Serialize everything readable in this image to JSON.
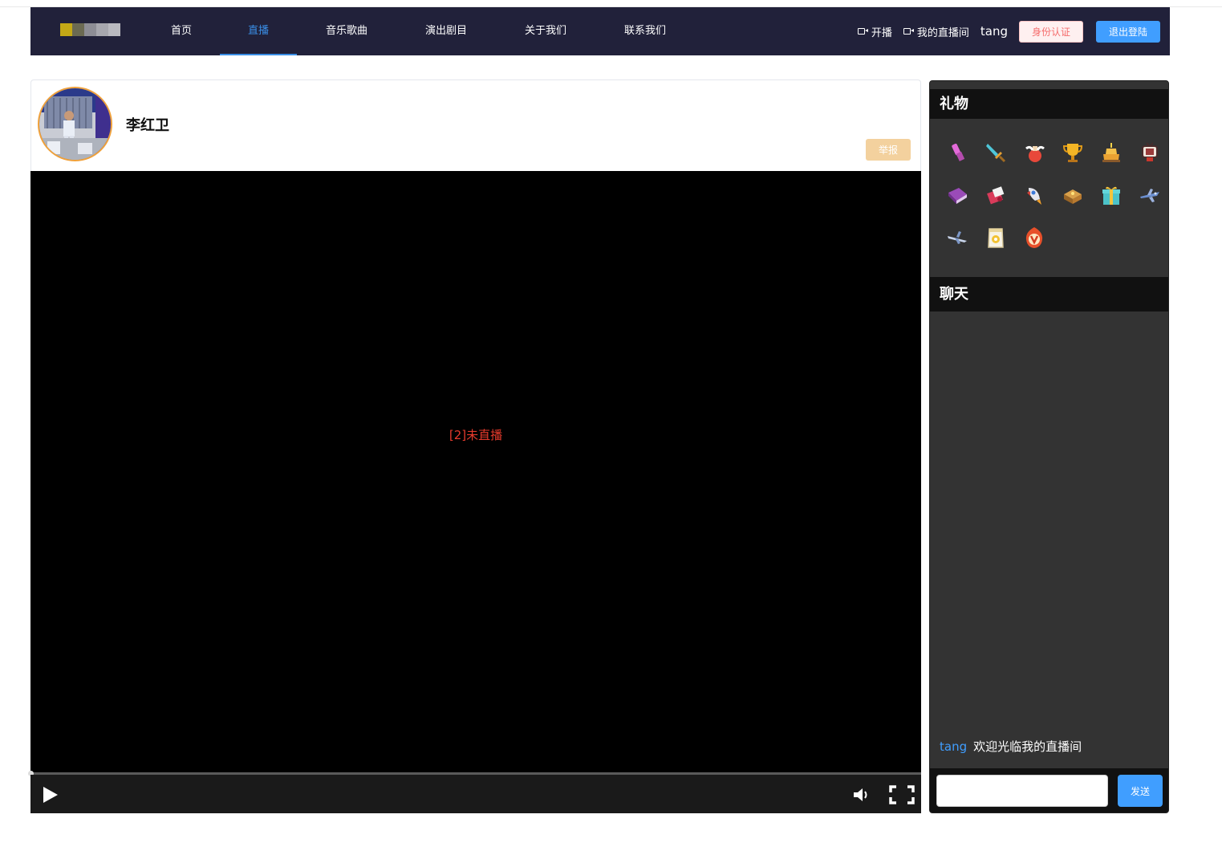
{
  "header": {
    "nav": [
      {
        "label": "首页",
        "active": false
      },
      {
        "label": "直播",
        "active": true
      },
      {
        "label": "音乐歌曲",
        "active": false
      },
      {
        "label": "演出剧目",
        "active": false
      },
      {
        "label": "关于我们",
        "active": false
      },
      {
        "label": "联系我们",
        "active": false
      }
    ],
    "start_stream_label": "开播",
    "my_room_label": "我的直播间",
    "username": "tang",
    "verify_label": "身份认证",
    "logout_label": "退出登陆"
  },
  "streamer": {
    "name": "李红卫",
    "report_label": "举报"
  },
  "video": {
    "status_text": "[2]未直播",
    "progress": 0
  },
  "gifts": {
    "title": "礼物",
    "items": [
      {
        "icon": "lipstick-icon"
      },
      {
        "icon": "sword-icon"
      },
      {
        "icon": "potion-icon"
      },
      {
        "icon": "trophy-icon"
      },
      {
        "icon": "cake-icon"
      },
      {
        "icon": "tv-icon"
      },
      {
        "icon": "book-icon"
      },
      {
        "icon": "love-letter-icon"
      },
      {
        "icon": "rocket-icon"
      },
      {
        "icon": "treasure-chest-icon"
      },
      {
        "icon": "gift-box-icon"
      },
      {
        "icon": "jet-icon"
      },
      {
        "icon": "airplane-icon"
      },
      {
        "icon": "snack-bag-icon"
      },
      {
        "icon": "v-badge-icon"
      }
    ]
  },
  "chat": {
    "title": "聊天",
    "messages": [
      {
        "user": "tang",
        "text": "欢迎光临我的直播间"
      }
    ],
    "input_value": "",
    "send_label": "发送"
  }
}
